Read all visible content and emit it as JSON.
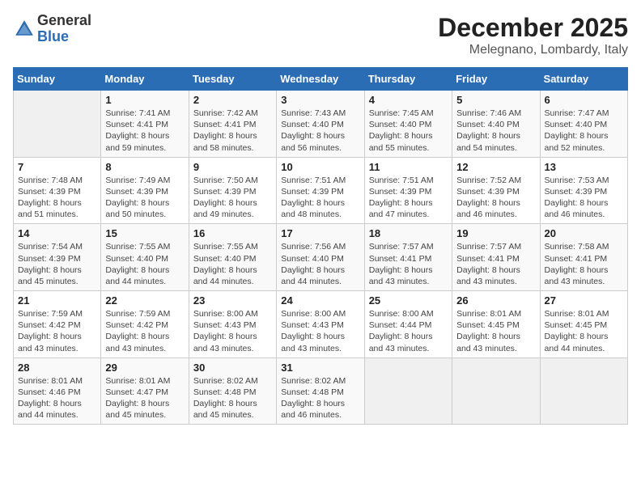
{
  "logo": {
    "general": "General",
    "blue": "Blue"
  },
  "header": {
    "month": "December 2025",
    "location": "Melegnano, Lombardy, Italy"
  },
  "weekdays": [
    "Sunday",
    "Monday",
    "Tuesday",
    "Wednesday",
    "Thursday",
    "Friday",
    "Saturday"
  ],
  "weeks": [
    [
      {
        "day": "",
        "info": ""
      },
      {
        "day": "1",
        "info": "Sunrise: 7:41 AM\nSunset: 4:41 PM\nDaylight: 8 hours\nand 59 minutes."
      },
      {
        "day": "2",
        "info": "Sunrise: 7:42 AM\nSunset: 4:41 PM\nDaylight: 8 hours\nand 58 minutes."
      },
      {
        "day": "3",
        "info": "Sunrise: 7:43 AM\nSunset: 4:40 PM\nDaylight: 8 hours\nand 56 minutes."
      },
      {
        "day": "4",
        "info": "Sunrise: 7:45 AM\nSunset: 4:40 PM\nDaylight: 8 hours\nand 55 minutes."
      },
      {
        "day": "5",
        "info": "Sunrise: 7:46 AM\nSunset: 4:40 PM\nDaylight: 8 hours\nand 54 minutes."
      },
      {
        "day": "6",
        "info": "Sunrise: 7:47 AM\nSunset: 4:40 PM\nDaylight: 8 hours\nand 52 minutes."
      }
    ],
    [
      {
        "day": "7",
        "info": "Sunrise: 7:48 AM\nSunset: 4:39 PM\nDaylight: 8 hours\nand 51 minutes."
      },
      {
        "day": "8",
        "info": "Sunrise: 7:49 AM\nSunset: 4:39 PM\nDaylight: 8 hours\nand 50 minutes."
      },
      {
        "day": "9",
        "info": "Sunrise: 7:50 AM\nSunset: 4:39 PM\nDaylight: 8 hours\nand 49 minutes."
      },
      {
        "day": "10",
        "info": "Sunrise: 7:51 AM\nSunset: 4:39 PM\nDaylight: 8 hours\nand 48 minutes."
      },
      {
        "day": "11",
        "info": "Sunrise: 7:51 AM\nSunset: 4:39 PM\nDaylight: 8 hours\nand 47 minutes."
      },
      {
        "day": "12",
        "info": "Sunrise: 7:52 AM\nSunset: 4:39 PM\nDaylight: 8 hours\nand 46 minutes."
      },
      {
        "day": "13",
        "info": "Sunrise: 7:53 AM\nSunset: 4:39 PM\nDaylight: 8 hours\nand 46 minutes."
      }
    ],
    [
      {
        "day": "14",
        "info": "Sunrise: 7:54 AM\nSunset: 4:39 PM\nDaylight: 8 hours\nand 45 minutes."
      },
      {
        "day": "15",
        "info": "Sunrise: 7:55 AM\nSunset: 4:40 PM\nDaylight: 8 hours\nand 44 minutes."
      },
      {
        "day": "16",
        "info": "Sunrise: 7:55 AM\nSunset: 4:40 PM\nDaylight: 8 hours\nand 44 minutes."
      },
      {
        "day": "17",
        "info": "Sunrise: 7:56 AM\nSunset: 4:40 PM\nDaylight: 8 hours\nand 44 minutes."
      },
      {
        "day": "18",
        "info": "Sunrise: 7:57 AM\nSunset: 4:41 PM\nDaylight: 8 hours\nand 43 minutes."
      },
      {
        "day": "19",
        "info": "Sunrise: 7:57 AM\nSunset: 4:41 PM\nDaylight: 8 hours\nand 43 minutes."
      },
      {
        "day": "20",
        "info": "Sunrise: 7:58 AM\nSunset: 4:41 PM\nDaylight: 8 hours\nand 43 minutes."
      }
    ],
    [
      {
        "day": "21",
        "info": "Sunrise: 7:59 AM\nSunset: 4:42 PM\nDaylight: 8 hours\nand 43 minutes."
      },
      {
        "day": "22",
        "info": "Sunrise: 7:59 AM\nSunset: 4:42 PM\nDaylight: 8 hours\nand 43 minutes."
      },
      {
        "day": "23",
        "info": "Sunrise: 8:00 AM\nSunset: 4:43 PM\nDaylight: 8 hours\nand 43 minutes."
      },
      {
        "day": "24",
        "info": "Sunrise: 8:00 AM\nSunset: 4:43 PM\nDaylight: 8 hours\nand 43 minutes."
      },
      {
        "day": "25",
        "info": "Sunrise: 8:00 AM\nSunset: 4:44 PM\nDaylight: 8 hours\nand 43 minutes."
      },
      {
        "day": "26",
        "info": "Sunrise: 8:01 AM\nSunset: 4:45 PM\nDaylight: 8 hours\nand 43 minutes."
      },
      {
        "day": "27",
        "info": "Sunrise: 8:01 AM\nSunset: 4:45 PM\nDaylight: 8 hours\nand 44 minutes."
      }
    ],
    [
      {
        "day": "28",
        "info": "Sunrise: 8:01 AM\nSunset: 4:46 PM\nDaylight: 8 hours\nand 44 minutes."
      },
      {
        "day": "29",
        "info": "Sunrise: 8:01 AM\nSunset: 4:47 PM\nDaylight: 8 hours\nand 45 minutes."
      },
      {
        "day": "30",
        "info": "Sunrise: 8:02 AM\nSunset: 4:48 PM\nDaylight: 8 hours\nand 45 minutes."
      },
      {
        "day": "31",
        "info": "Sunrise: 8:02 AM\nSunset: 4:48 PM\nDaylight: 8 hours\nand 46 minutes."
      },
      {
        "day": "",
        "info": ""
      },
      {
        "day": "",
        "info": ""
      },
      {
        "day": "",
        "info": ""
      }
    ]
  ]
}
